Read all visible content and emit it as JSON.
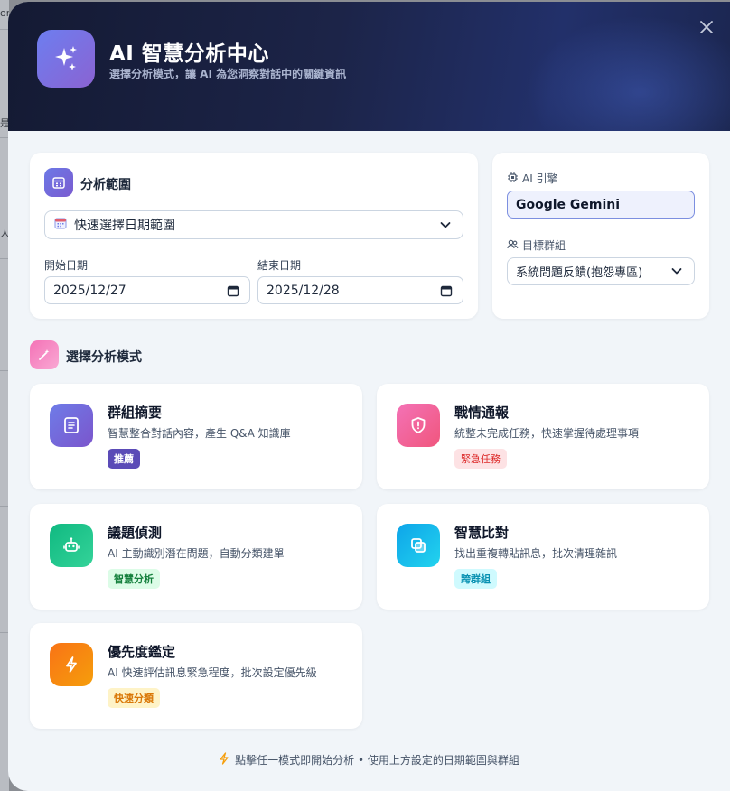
{
  "header": {
    "title": "AI 智慧分析中心",
    "subtitle": "選擇分析模式，讓 AI 為您洞察對話中的關鍵資訊"
  },
  "range": {
    "title": "分析範圍",
    "quick_select": "快速選擇日期範圍",
    "start_label": "開始日期",
    "start_value": "2025/12/27",
    "end_label": "結束日期",
    "end_value": "2025/12/28"
  },
  "engine": {
    "label": "AI 引擎",
    "value": "Google Gemini",
    "group_label": "目標群組",
    "group_value": "系統問題反饋(抱怨專區)"
  },
  "modes_heading": "選擇分析模式",
  "modes": [
    {
      "title": "群組摘要",
      "desc": "智慧整合對話內容，產生 Q&A 知識庫",
      "badge": "推薦"
    },
    {
      "title": "戰情通報",
      "desc": "統整未完成任務，快速掌握待處理事項",
      "badge": "緊急任務"
    },
    {
      "title": "議題偵測",
      "desc": "AI 主動識別潛在問題，自動分類建單",
      "badge": "智慧分析"
    },
    {
      "title": "智慧比對",
      "desc": "找出重複轉貼訊息，批次清理雜訊",
      "badge": "跨群組"
    },
    {
      "title": "優先度鑑定",
      "desc": "AI 快速評估訊息緊急程度，批次設定優先級",
      "badge": "快速分類"
    }
  ],
  "footer": "點擊任一模式即開始分析 • 使用上方設定的日期範圍與群組",
  "background": {
    "fragments": [
      "orc",
      "是p",
      "人"
    ]
  },
  "colors": {
    "header_start": "#141a33",
    "accent": "#6d7ef0",
    "summary_badge_bg": "#5b4bb7",
    "urgent_badge_bg": "#fde2e4",
    "smart_badge_bg": "#dcfce7",
    "cross_badge_bg": "#cffafe",
    "quick_badge_bg": "#fef3c7"
  }
}
